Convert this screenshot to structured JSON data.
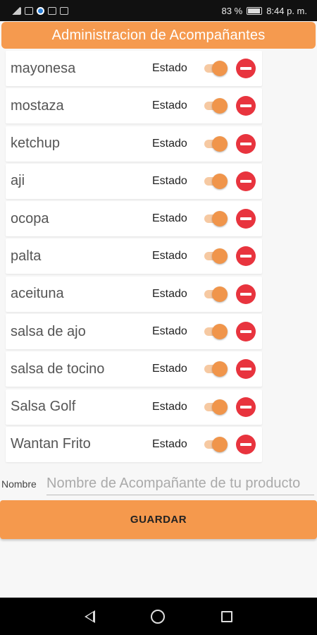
{
  "status_bar": {
    "battery": "83 %",
    "time": "8:44 p. m."
  },
  "app_bar": {
    "title": "Administracion de Acompañantes"
  },
  "items": [
    {
      "name": "mayonesa",
      "estado_label": "Estado",
      "enabled": true
    },
    {
      "name": "mostaza",
      "estado_label": "Estado",
      "enabled": true
    },
    {
      "name": "ketchup",
      "estado_label": "Estado",
      "enabled": true
    },
    {
      "name": "aji",
      "estado_label": "Estado",
      "enabled": true
    },
    {
      "name": "ocopa",
      "estado_label": "Estado",
      "enabled": true
    },
    {
      "name": "palta",
      "estado_label": "Estado",
      "enabled": true
    },
    {
      "name": "aceituna",
      "estado_label": "Estado",
      "enabled": true
    },
    {
      "name": "salsa de ajo",
      "estado_label": "Estado",
      "enabled": true
    },
    {
      "name": "salsa de tocino",
      "estado_label": "Estado",
      "enabled": true
    },
    {
      "name": "Salsa Golf",
      "estado_label": "Estado",
      "enabled": true
    },
    {
      "name": "Wantan Frito",
      "estado_label": "Estado",
      "enabled": true
    }
  ],
  "form": {
    "name_label": "Nombre",
    "name_placeholder": "Nombre de Acompañante de tu producto",
    "name_value": ""
  },
  "save_label": "GUARDAR",
  "colors": {
    "accent": "#f59a4f",
    "delete": "#e8343e",
    "switch_thumb": "#f0954b",
    "switch_track": "#f6c9a2"
  },
  "icons": {
    "delete": "remove-circle-icon",
    "nav_back": "back-triangle-icon",
    "nav_home": "home-circle-icon",
    "nav_recent": "recent-apps-square-icon"
  }
}
